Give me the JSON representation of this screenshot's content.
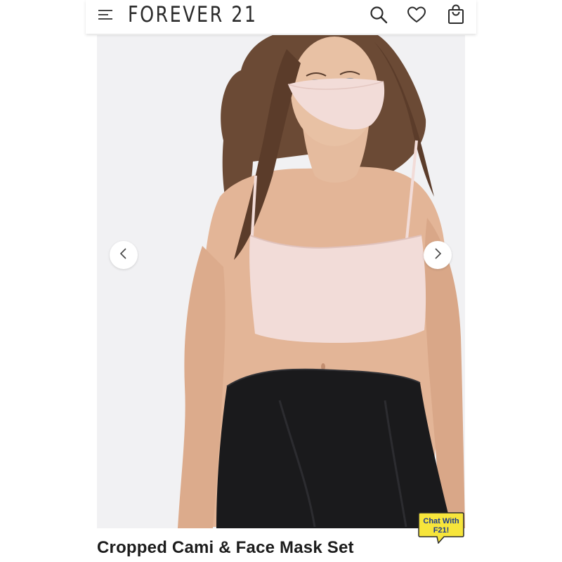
{
  "header": {
    "brand": "FOREVER 21",
    "icons": {
      "menu": "hamburger-menu-icon",
      "search": "search-icon",
      "wishlist": "heart-icon",
      "bag": "shopping-bag-icon"
    }
  },
  "gallery": {
    "prev_icon": "chevron-left-icon",
    "next_icon": "chevron-right-icon"
  },
  "product": {
    "title": "Cropped Cami & Face Mask Set",
    "top_color": "#f2dcd8",
    "bottom_color": "#1a1a1c"
  },
  "chat": {
    "line1": "Chat With",
    "line2": "F21!",
    "bubble_color": "#f7e53b"
  }
}
